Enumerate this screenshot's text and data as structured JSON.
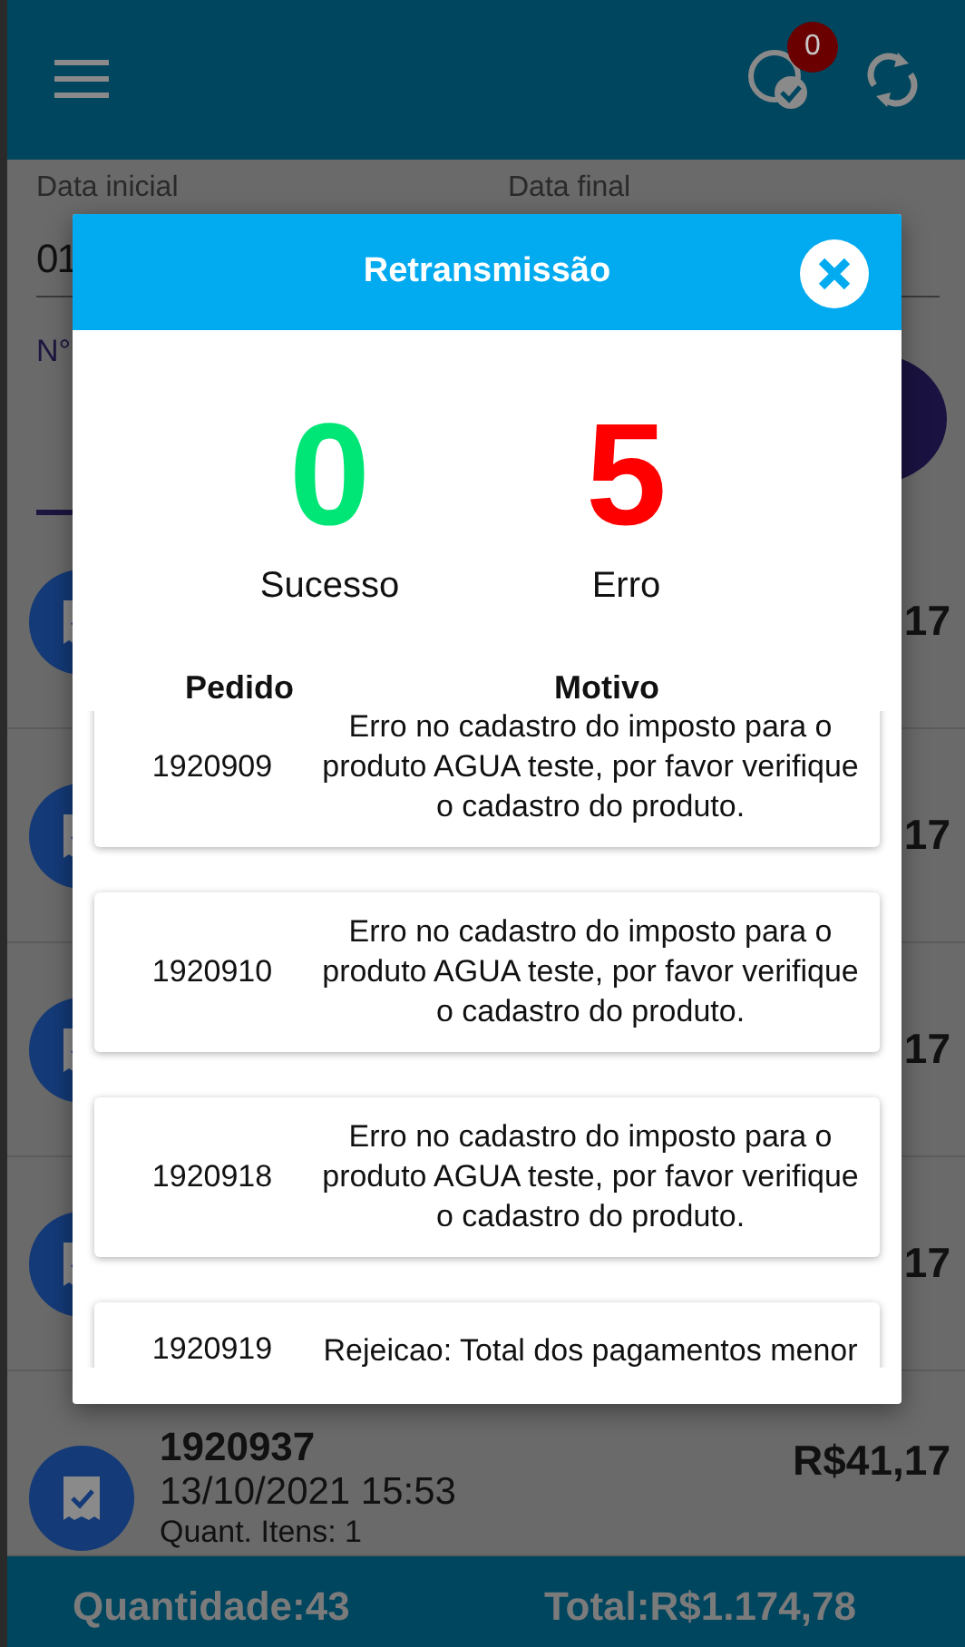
{
  "app_bar": {
    "badge": "0"
  },
  "filters": {
    "start_label": "Data inicial",
    "start_value": "01",
    "end_label": "Data final",
    "number_label": "N°"
  },
  "orders": [
    {
      "amount": "17"
    },
    {
      "amount": "17"
    },
    {
      "amount": "17"
    },
    {
      "amount": "17"
    },
    {
      "number": "1920937",
      "date": "13/10/2021 15:53",
      "items": "Quant. Itens: 1",
      "amount": "R$41,17"
    }
  ],
  "footer": {
    "quantity": "Quantidade:43",
    "total": "Total:R$1.174,78"
  },
  "dialog": {
    "title": "Retransmissão",
    "stats": [
      {
        "value": "0",
        "label": "Sucesso",
        "kind": "success"
      },
      {
        "value": "5",
        "label": "Erro",
        "kind": "error"
      }
    ],
    "columns": [
      "Pedido",
      "Motivo"
    ],
    "rows": [
      {
        "order": "1920909",
        "reason": "Erro no cadastro do imposto para o produto AGUA teste, por favor verifique o cadastro do produto."
      },
      {
        "order": "1920910",
        "reason": "Erro no cadastro do imposto para o produto AGUA teste, por favor verifique o cadastro do produto."
      },
      {
        "order": "1920918",
        "reason": "Erro no cadastro do imposto para o produto AGUA teste, por favor verifique o cadastro do produto."
      },
      {
        "order": "1920919",
        "reason": "Rejeicao: Total dos pagamentos menor"
      }
    ]
  }
}
